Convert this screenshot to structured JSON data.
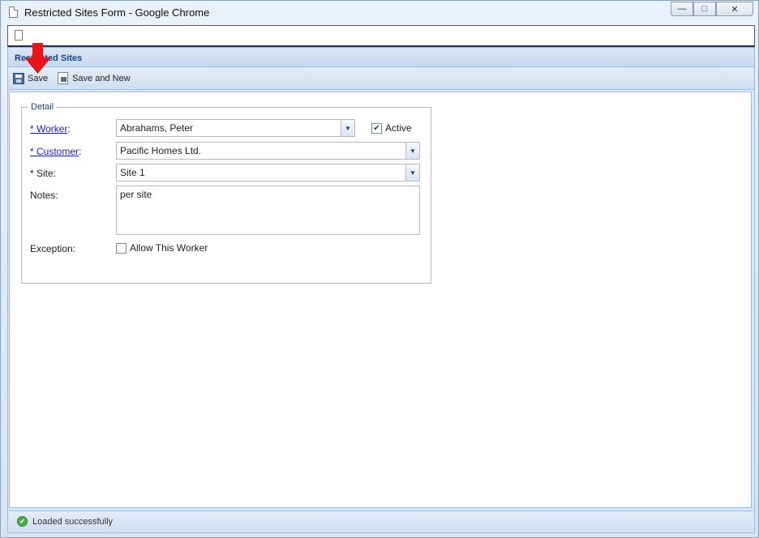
{
  "window": {
    "title": "Restricted Sites Form - Google Chrome",
    "minimize_glyph": "—",
    "maximize_glyph": "□",
    "close_glyph": "✕"
  },
  "panel": {
    "title": "Restricted Sites"
  },
  "toolbar": {
    "save_label": "Save",
    "save_and_new_label": "Save and New"
  },
  "form": {
    "legend": "Detail",
    "worker": {
      "label": "* Worker",
      "colon": ":",
      "value": "Abrahams, Peter"
    },
    "active": {
      "label": "Active",
      "checked": true
    },
    "customer": {
      "label": "* Customer",
      "colon": ":",
      "value": "Pacific Homes Ltd."
    },
    "site": {
      "label": "* Site:",
      "value": "Site 1"
    },
    "notes": {
      "label": "Notes:",
      "value": "per site"
    },
    "exception": {
      "label": "Exception:",
      "checkbox_label": "Allow This Worker",
      "checked": false
    }
  },
  "status": {
    "text": "Loaded successfully"
  },
  "colors": {
    "accent_title": "#15428b",
    "link": "#1a1ad1",
    "annotation_arrow": "#e8141a"
  }
}
